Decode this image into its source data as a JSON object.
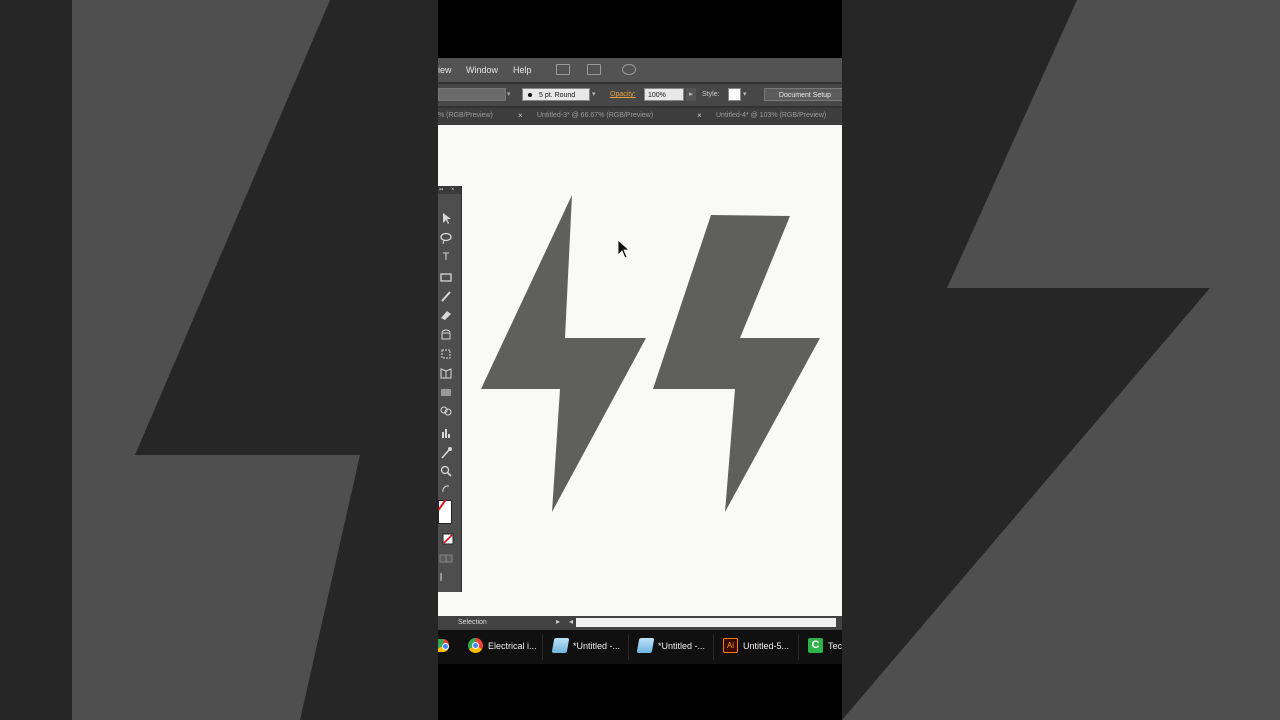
{
  "menubar": {
    "items": [
      "iew",
      "Window",
      "Help"
    ]
  },
  "controlbar": {
    "brush": "5 pt. Round",
    "opacity_label": "Opacity:",
    "opacity_value": "100%",
    "style_label": "Style:",
    "document_setup": "Document Setup"
  },
  "tabs": [
    {
      "label": "% (RGB/Preview)"
    },
    {
      "label": "Untitled-3* @ 66.67% (RGB/Preview)"
    },
    {
      "label": "Untitled-4* @ 103% (RGB/Preview)"
    }
  ],
  "tab_close": "×",
  "tools": {
    "type": "T",
    "panel_close": "×"
  },
  "status": {
    "tool": "Selection"
  },
  "taskbar": {
    "items": [
      {
        "label": "Electrical i...",
        "icon": "chrome-icon"
      },
      {
        "label": "*Untitled -...",
        "icon": "notepad-icon"
      },
      {
        "label": "*Untitled -...",
        "icon": "notepad-icon"
      },
      {
        "label": "Untitled-5...",
        "icon": "illustrator-icon"
      },
      {
        "label": "Tec",
        "icon": "camtasia-icon"
      }
    ],
    "ai_glyph": "Ai",
    "camtasia_glyph": "C"
  },
  "colors": {
    "bolt_fill": "#5f605e",
    "artboard": "#f9faf7",
    "opacity_accent": "#e8a23a"
  }
}
